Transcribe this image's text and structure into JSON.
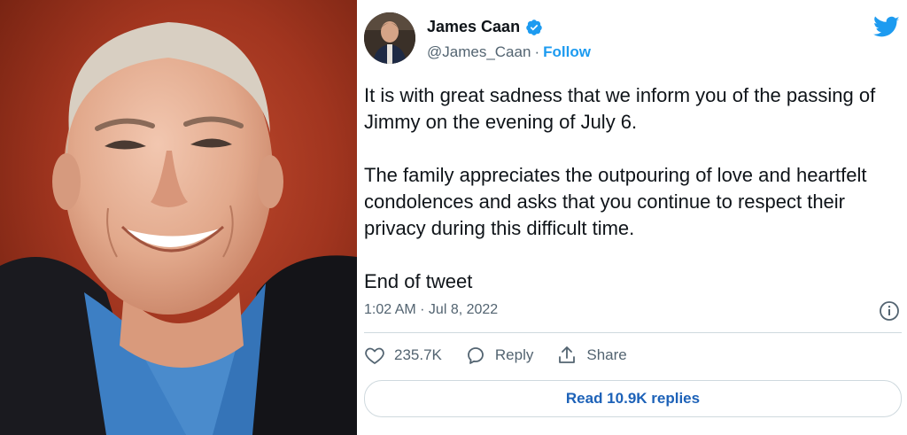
{
  "photo": {
    "subject": "portrait-photo",
    "background_color": "#a1351f"
  },
  "tweet": {
    "author": {
      "display_name": "James Caan",
      "handle": "@James_Caan",
      "separator": "·",
      "follow_label": "Follow"
    },
    "paragraphs": [
      "It is with great sadness that we inform you of the passing of Jimmy on the evening of July 6.",
      "The family appreciates the outpouring of love and heartfelt condolences and asks that you continue to respect their privacy during this difficult time.",
      "End of tweet"
    ],
    "timestamp": "1:02 AM · Jul 8, 2022",
    "actions": {
      "like_count": "235.7K",
      "reply_label": "Reply",
      "share_label": "Share"
    },
    "read_replies_label": "Read 10.9K replies"
  },
  "colors": {
    "accent": "#1d9bf0",
    "link": "#1d62b8",
    "muted": "#536471",
    "text": "#0f1419",
    "divider": "#cfd9de"
  },
  "icons": [
    "verified-badge-icon",
    "twitter-bird-icon",
    "info-icon",
    "heart-icon",
    "reply-icon",
    "share-icon"
  ]
}
